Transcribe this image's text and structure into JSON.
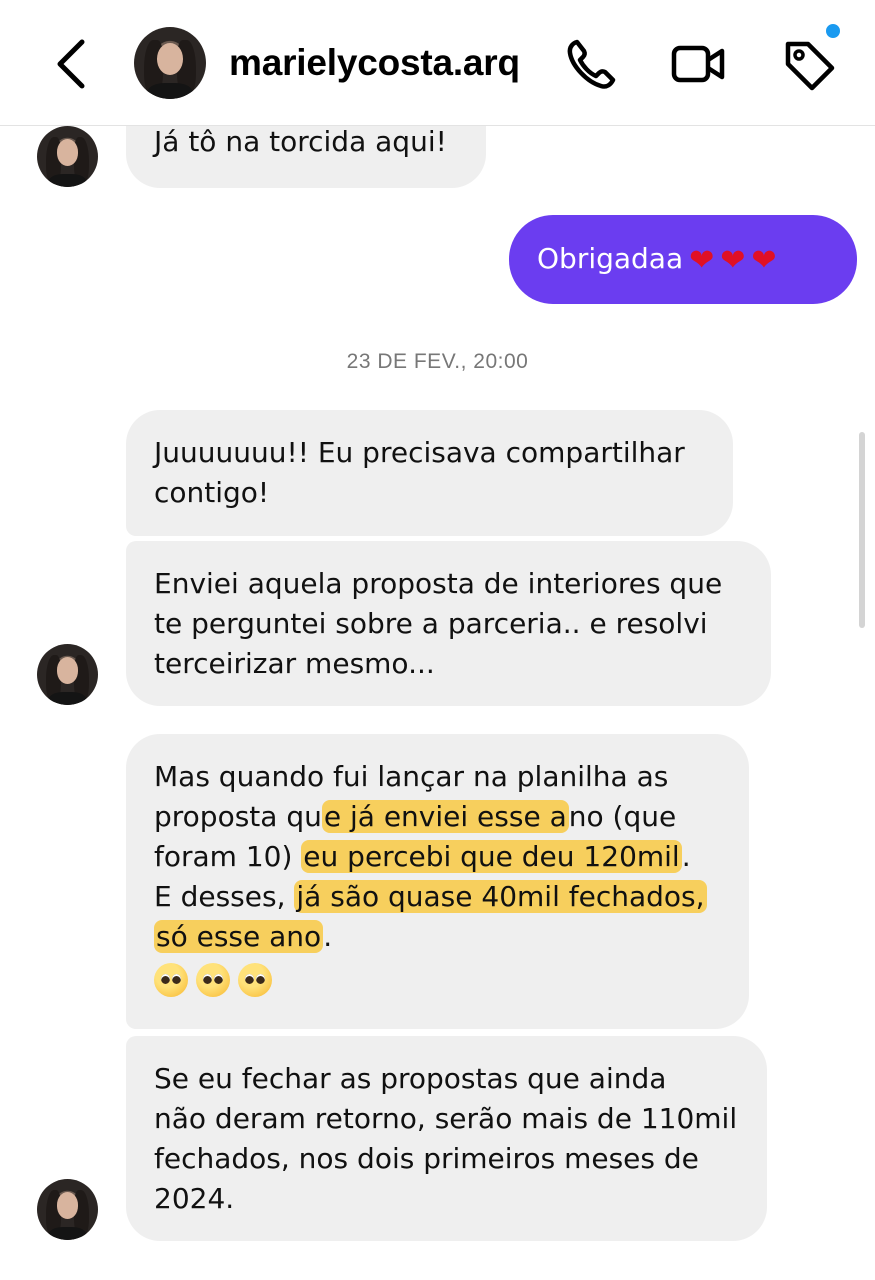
{
  "header": {
    "username": "marielycosta.arq",
    "back_icon": "chevron-left-icon",
    "call_icon": "phone-icon",
    "video_icon": "video-icon",
    "tag_icon": "tag-icon",
    "notification_dot_color": "#1a9af0"
  },
  "colors": {
    "outgoing_bubble": "#6b3df0",
    "incoming_bubble": "#efefef",
    "highlight": "#f7cf5d"
  },
  "messages": [
    {
      "lines": [
        "Já tô na torcida aqui!"
      ]
    },
    {
      "text": "Obrigadaa",
      "hearts": [
        "❤",
        "❤",
        "❤"
      ]
    },
    {
      "lines": [
        "Juuuuuuu!! Eu precisava compartilhar",
        "contigo!"
      ]
    },
    {
      "lines": [
        "Enviei aquela proposta de interiores que",
        "te perguntei sobre a parceria.. e resolvi",
        "terceirizar mesmo..."
      ]
    },
    {
      "line1": "Mas quando fui lançar na planilha as",
      "line2_a": "proposta qu",
      "line2_b": "e já enviei esse a",
      "line2_c": "no (que",
      "line3_a": "foram 10) ",
      "line3_b": "eu percebi que deu 120mil",
      "line3_c": ".",
      "line4_a": "E desses, ",
      "line4_b": "já são quase 40mil fechados,",
      "line5_a": "só esse ano",
      "line5_b": ".",
      "emojis": [
        "pleading-face-emoji",
        "pleading-face-emoji",
        "pleading-face-emoji"
      ]
    },
    {
      "lines": [
        "Se eu fechar as propostas que ainda",
        "não deram retorno, serão mais de 110mil",
        "fechados, nos dois primeiros meses de",
        "2024."
      ]
    }
  ],
  "timestamp": "23 DE FEV., 20:00"
}
